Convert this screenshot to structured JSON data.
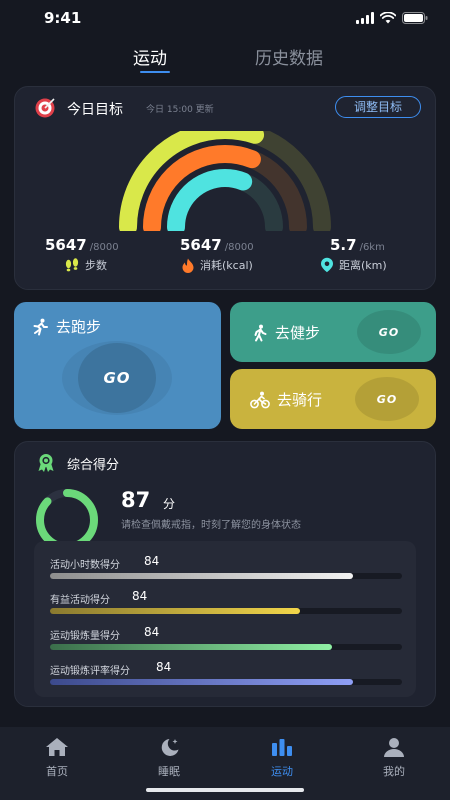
{
  "status": {
    "time": "9:41"
  },
  "top_tabs": [
    {
      "label": "运动",
      "active": true
    },
    {
      "label": "历史数据",
      "active": false
    }
  ],
  "goal": {
    "title": "今日目标",
    "updated": "今日 15:00 更新",
    "adjust_label": "调整目标",
    "metrics": [
      {
        "value": "5647",
        "target": "/8000",
        "label": "步数",
        "icon": "footprints-icon"
      },
      {
        "value": "5647",
        "target": "/8000",
        "label": "消耗(kcal)",
        "icon": "flame-icon"
      },
      {
        "value": "5.7",
        "target": "/6km",
        "label": "距离(km)",
        "icon": "location-pin-icon"
      }
    ],
    "rings": [
      {
        "fraction": 0.6,
        "color": "#d9e84a",
        "track": "#3f4232"
      },
      {
        "fraction": 0.62,
        "color": "#ff7a2a",
        "track": "#43342d"
      },
      {
        "fraction": 0.62,
        "color": "#4fe3e0",
        "track": "#2a3b40"
      }
    ]
  },
  "activities": {
    "run": {
      "label": "去跑步",
      "go": "GO"
    },
    "walk": {
      "label": "去健步",
      "go": "GO"
    },
    "ride": {
      "label": "去骑行",
      "go": "GO"
    }
  },
  "score": {
    "title": "综合得分",
    "value": "87",
    "unit": "分",
    "hint": "请检查佩戴戒指，时刻了解您的身体状态",
    "fraction": 0.87,
    "color": "#6bd97a",
    "items": [
      {
        "label": "活动小时数得分",
        "value": "84",
        "fraction": 0.86,
        "color_from": "#8e8e8e",
        "color_to": "#f2f2f2"
      },
      {
        "label": "有益活动得分",
        "value": "84",
        "fraction": 0.71,
        "color_from": "#8a7a2f",
        "color_to": "#f2d64a"
      },
      {
        "label": "运动锻炼量得分",
        "value": "84",
        "fraction": 0.8,
        "color_from": "#3b6e4b",
        "color_to": "#8ff0a4"
      },
      {
        "label": "运动锻炼评率得分",
        "value": "84",
        "fraction": 0.86,
        "color_from": "#3c4a8c",
        "color_to": "#8f9ff5"
      }
    ]
  },
  "nav": [
    {
      "label": "首页",
      "icon": "home-icon",
      "active": false
    },
    {
      "label": "睡眠",
      "icon": "moon-icon",
      "active": false
    },
    {
      "label": "运动",
      "icon": "bar-chart-icon",
      "active": true
    },
    {
      "label": "我的",
      "icon": "person-icon",
      "active": false
    }
  ],
  "colors": {
    "accent": "#3e8ef0",
    "background": "#151821",
    "card": "#1f2330"
  }
}
